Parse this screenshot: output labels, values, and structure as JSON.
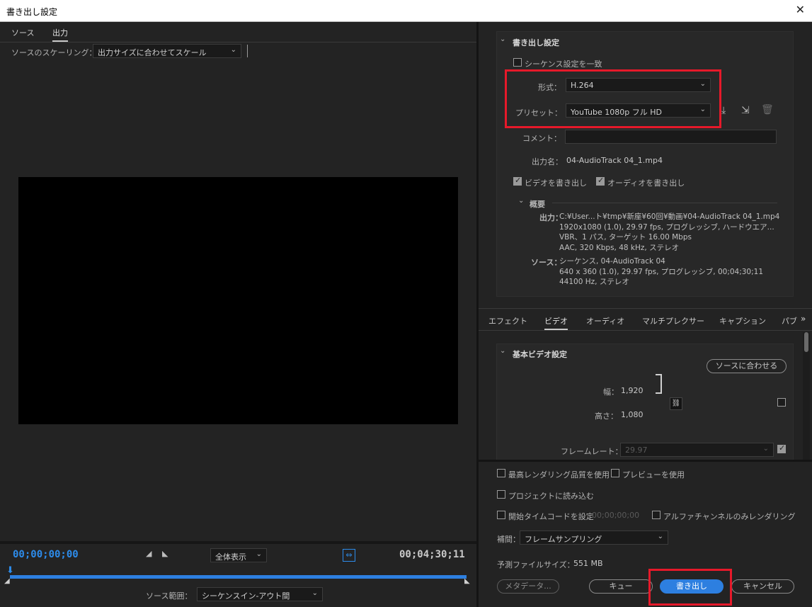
{
  "window": {
    "title": "書き出し設定",
    "close": "✕"
  },
  "left": {
    "tabs": [
      "ソース",
      "出力"
    ],
    "scaling_label": "ソースのスケーリング：",
    "scaling_value": "出力サイズに合わせてスケール",
    "timecode_start": "00;00;00;00",
    "timecode_end": "00;04;30;11",
    "zoom_value": "全体表示",
    "range_label": "ソース範囲：",
    "range_value": "シーケンスイン-アウト間"
  },
  "export_settings": {
    "header": "書き出し設定",
    "match_sequence": "シーケンス設定を一致",
    "format_label": "形式：",
    "format_value": "H.264",
    "preset_label": "プリセット：",
    "preset_value": "YouTube  1080p フル HD",
    "comment_label": "コメント：",
    "output_name_label": "出力名：",
    "output_name_value": "04-AudioTrack 04_1.mp4",
    "export_video": "ビデオを書き出し",
    "export_audio": "オーディオを書き出し",
    "summary_header": "概要",
    "output_label": "出力：",
    "output_lines": [
      "C:¥User...ト¥tmp¥新座¥60回¥動画¥04-AudioTrack 04_1.mp4",
      "1920x1080 (1.0), 29.97 fps, プログレッシブ, ハードウエア...",
      "VBR、1 パス, ターゲット 16.00 Mbps",
      "AAC, 320 Kbps, 48 kHz, ステレオ"
    ],
    "source_label": "ソース：",
    "source_lines": [
      "シーケンス, 04-AudioTrack 04",
      "640 x 360 (1.0), 29.97 fps, プログレッシブ, 00;04;30;11",
      "44100  Hz, ステレオ"
    ]
  },
  "tabs2": [
    "エフェクト",
    "ビデオ",
    "オーディオ",
    "マルチプレクサー",
    "キャプション",
    "パブ"
  ],
  "video": {
    "header": "基本ビデオ設定",
    "match_source": "ソースに合わせる",
    "width_label": "幅：",
    "width_value": "1,920",
    "height_label": "高さ：",
    "height_value": "1,080",
    "framerate_label": "フレームレート：",
    "framerate_value": "29.97"
  },
  "bottom": {
    "max_render": "最高レンダリング品質を使用",
    "use_preview": "プレビューを使用",
    "import_project": "プロジェクトに読み込む",
    "start_timecode": "開始タイムコードを設定",
    "start_timecode_value": "00;00;00;00",
    "alpha_only": "アルファチャンネルのみレンダリング",
    "interp_label": "補間：",
    "interp_value": "フレームサンプリング",
    "filesize_label": "予測ファイルサイズ：",
    "filesize_value": "551 MB",
    "metadata_btn": "メタデータ...",
    "queue_btn": "キュー",
    "export_btn": "書き出し",
    "cancel_btn": "キャンセル"
  },
  "colors": {
    "accent": "#2d8ceb",
    "highlight": "#e6192a",
    "primary_button": "#2d7fe0"
  }
}
